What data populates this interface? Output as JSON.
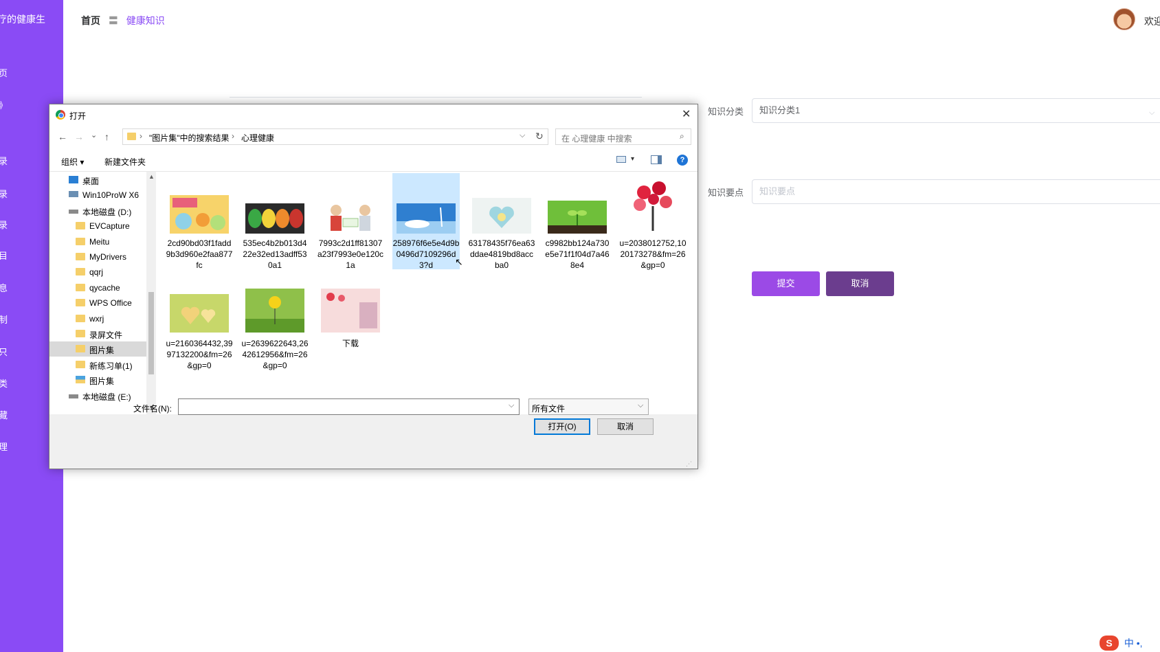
{
  "app": {
    "brand": "疗的健康生",
    "sidebar_items": [
      "页",
      "》",
      "录",
      "录",
      "录",
      "目",
      "息",
      "制",
      "只",
      "类",
      "藏",
      "理"
    ],
    "breadcrumb": {
      "home": "首页",
      "separator": "〓",
      "current": "健康知识"
    },
    "welcome": "欢迎",
    "form": {
      "category_label": "知识分类",
      "category_value": "知识分类1",
      "points_label": "知识要点",
      "points_placeholder": "知识要点",
      "submit_label": "提交",
      "cancel_label": "取消"
    },
    "ime": {
      "logo": "S",
      "text": "中 •,"
    }
  },
  "dialog": {
    "title": "打开",
    "close": "✕",
    "nav": {
      "back": "←",
      "forward": "→",
      "recent": "⌄",
      "up": "↑"
    },
    "address": {
      "segments": [
        "\"图片集\"中的搜索结果",
        "心理健康"
      ],
      "chevron": "›",
      "dropdown": "⌵",
      "refresh": "↻"
    },
    "search_placeholder": "在 心理健康 中搜索",
    "search_icon": "⌕",
    "commands": {
      "organize": "组织 ▾",
      "new_folder": "新建文件夹"
    },
    "help": "?",
    "tree": [
      {
        "label": "桌面",
        "icon": "desktop-icon"
      },
      {
        "label": "Win10ProW X6",
        "icon": "computer-icon"
      },
      {
        "label": "本地磁盘 (D:)",
        "icon": "drive-icon"
      },
      {
        "label": "EVCapture",
        "icon": "folder-icon"
      },
      {
        "label": "Meitu",
        "icon": "folder-icon"
      },
      {
        "label": "MyDrivers",
        "icon": "folder-icon"
      },
      {
        "label": "qqrj",
        "icon": "folder-icon"
      },
      {
        "label": "qycache",
        "icon": "folder-icon"
      },
      {
        "label": "WPS Office",
        "icon": "folder-icon"
      },
      {
        "label": "wxrj",
        "icon": "folder-icon"
      },
      {
        "label": "录屏文件",
        "icon": "folder-icon"
      },
      {
        "label": "图片集",
        "icon": "folder-icon",
        "selected": true
      },
      {
        "label": "新练习单(1)",
        "icon": "folder-icon"
      },
      {
        "label": "图片集",
        "icon": "library-icon"
      },
      {
        "label": "本地磁盘 (E:)",
        "icon": "drive-icon"
      }
    ],
    "files": [
      {
        "name": "2cd90bd03f1fadd9b3d960e2faa877fc"
      },
      {
        "name": "535ec4b2b013d422e32ed13adff530a1"
      },
      {
        "name": "7993c2d1ff81307a23f7993e0e120c1a"
      },
      {
        "name": "258976f6e5e4d9b0496d7109296d3?d",
        "selected": true
      },
      {
        "name": "63178435f76ea63ddae4819bd8accba0"
      },
      {
        "name": "c9982bb124a730e5e71f1f04d7a468e4"
      },
      {
        "name": "u=2038012752,1020173278&fm=26&gp=0"
      },
      {
        "name": "u=2160364432,3997132200&fm=26&gp=0"
      },
      {
        "name": "u=2639622643,2642612956&fm=26&gp=0"
      },
      {
        "name": "下载"
      }
    ],
    "filename_label": "文件名(N):",
    "filename_value": "",
    "filetype_value": "所有文件",
    "open_label": "打开(O)",
    "cancel_label": "取消"
  }
}
